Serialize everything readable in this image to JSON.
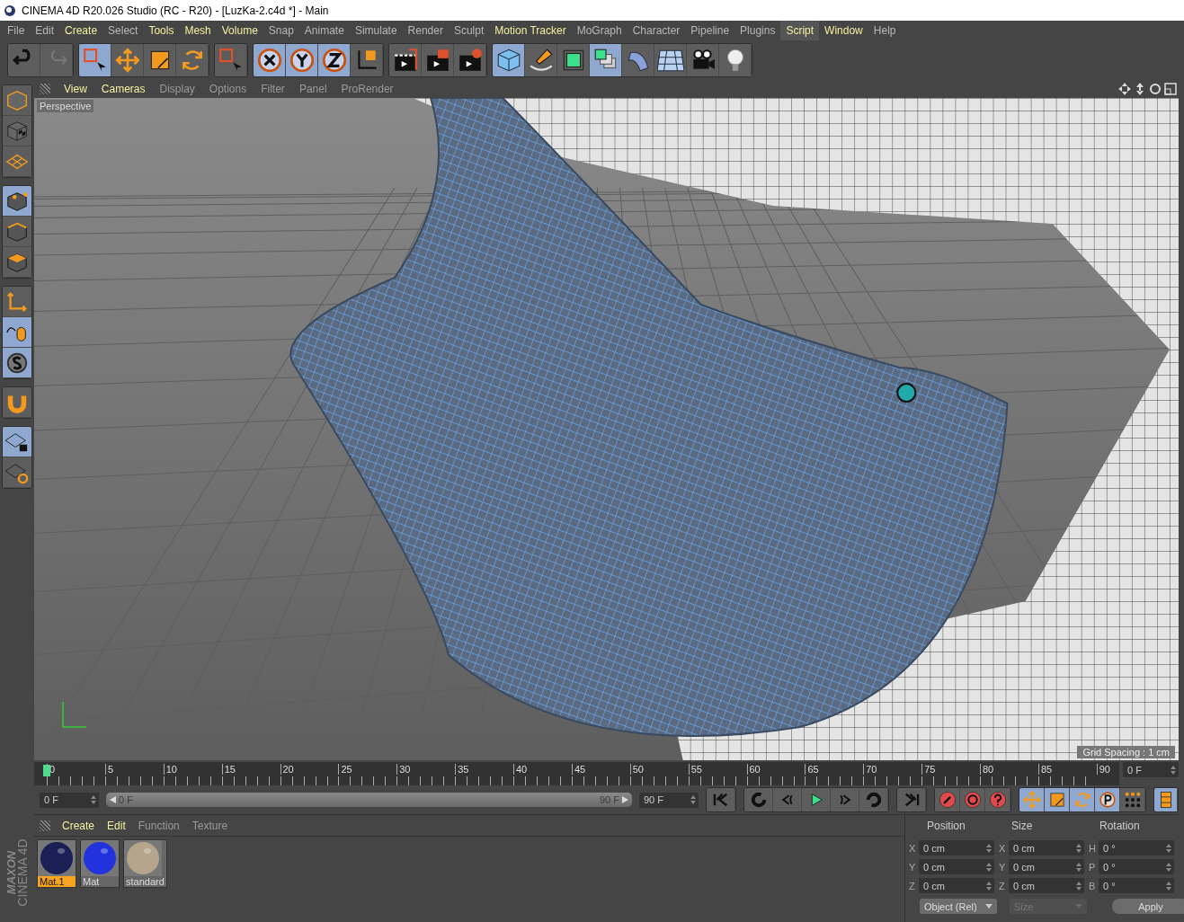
{
  "window": {
    "title": "CINEMA 4D R20.026 Studio (RC - R20) - [LuzKa-2.c4d *] - Main"
  },
  "menu": [
    {
      "label": "File",
      "accent": false,
      "selected": false
    },
    {
      "label": "Edit",
      "accent": false,
      "selected": false
    },
    {
      "label": "Create",
      "accent": true,
      "selected": false
    },
    {
      "label": "Select",
      "accent": false,
      "selected": false
    },
    {
      "label": "Tools",
      "accent": true,
      "selected": false
    },
    {
      "label": "Mesh",
      "accent": true,
      "selected": false
    },
    {
      "label": "Volume",
      "accent": true,
      "selected": false
    },
    {
      "label": "Snap",
      "accent": false,
      "selected": false
    },
    {
      "label": "Animate",
      "accent": false,
      "selected": false
    },
    {
      "label": "Simulate",
      "accent": false,
      "selected": false
    },
    {
      "label": "Render",
      "accent": false,
      "selected": false
    },
    {
      "label": "Sculpt",
      "accent": false,
      "selected": false
    },
    {
      "label": "Motion Tracker",
      "accent": true,
      "selected": false
    },
    {
      "label": "MoGraph",
      "accent": false,
      "selected": false
    },
    {
      "label": "Character",
      "accent": false,
      "selected": false
    },
    {
      "label": "Pipeline",
      "accent": false,
      "selected": false
    },
    {
      "label": "Plugins",
      "accent": false,
      "selected": false
    },
    {
      "label": "Script",
      "accent": true,
      "selected": true
    },
    {
      "label": "Window",
      "accent": true,
      "selected": false
    },
    {
      "label": "Help",
      "accent": false,
      "selected": false
    }
  ],
  "toolbar": [
    [
      {
        "kind": "undo",
        "active": false
      },
      {
        "kind": "redo",
        "active": false
      }
    ],
    [
      {
        "kind": "live-select",
        "active": true
      },
      {
        "kind": "move",
        "active": false
      },
      {
        "kind": "scale",
        "active": false
      },
      {
        "kind": "rotate",
        "active": false
      }
    ],
    [
      {
        "kind": "rect-select",
        "active": false
      }
    ],
    [
      {
        "kind": "x",
        "active": true
      },
      {
        "kind": "y",
        "active": true
      },
      {
        "kind": "z",
        "active": true
      },
      {
        "kind": "coord",
        "active": false
      }
    ],
    [
      {
        "kind": "render-view",
        "active": false
      },
      {
        "kind": "render-picture",
        "active": false
      },
      {
        "kind": "render-settings",
        "active": false
      }
    ],
    [
      {
        "kind": "cube",
        "active": true
      },
      {
        "kind": "pen",
        "active": false
      },
      {
        "kind": "subdivision",
        "active": false
      },
      {
        "kind": "cloner",
        "active": true
      },
      {
        "kind": "bend",
        "active": false
      },
      {
        "kind": "floor",
        "active": false
      },
      {
        "kind": "camera",
        "active": false
      },
      {
        "kind": "light",
        "active": false
      }
    ]
  ],
  "viewport": {
    "menu": [
      {
        "label": "View",
        "accent": true
      },
      {
        "label": "Cameras",
        "accent": true
      },
      {
        "label": "Display",
        "accent": false
      },
      {
        "label": "Options",
        "accent": false
      },
      {
        "label": "Filter",
        "accent": false
      },
      {
        "label": "Panel",
        "accent": false
      },
      {
        "label": "ProRender",
        "accent": false
      }
    ],
    "camera": "Perspective",
    "grid_spacing": "Grid Spacing : 1 cm"
  },
  "left_toolbar": [
    [
      {
        "kind": "model",
        "active": false
      },
      {
        "kind": "texture",
        "active": false
      },
      {
        "kind": "workplane",
        "active": false
      }
    ],
    [
      {
        "kind": "points",
        "active": true
      },
      {
        "kind": "edges",
        "active": false
      },
      {
        "kind": "polygons",
        "active": false
      }
    ],
    [
      {
        "kind": "axis",
        "active": false
      },
      {
        "kind": "tweak",
        "active": true
      },
      {
        "kind": "solo",
        "active": true
      }
    ],
    [
      {
        "kind": "magnet",
        "active": false
      }
    ],
    [
      {
        "kind": "lock-workplane",
        "active": true
      },
      {
        "kind": "planar-workplane",
        "active": false
      }
    ]
  ],
  "logo": {
    "brand": "MAXON",
    "product": "CINEMA 4D"
  },
  "timeline": {
    "ticks": [
      "0",
      "5",
      "10",
      "15",
      "20",
      "25",
      "30",
      "35",
      "40",
      "45",
      "50",
      "55",
      "60",
      "65",
      "70",
      "75",
      "80",
      "85",
      "90"
    ],
    "current_frame": "0 F",
    "start": "0 F",
    "range": {
      "start": "0 F",
      "end": "90 F"
    },
    "end": "90 F"
  },
  "transport": [
    [
      {
        "kind": "first"
      }
    ],
    [
      {
        "kind": "prev-key"
      },
      {
        "kind": "prev-frame"
      },
      {
        "kind": "play"
      },
      {
        "kind": "next-frame"
      },
      {
        "kind": "next-key"
      }
    ],
    [
      {
        "kind": "last"
      }
    ]
  ],
  "keys": [
    {
      "kind": "record",
      "active": false
    },
    {
      "kind": "autokey",
      "active": false
    },
    {
      "kind": "keyhelp",
      "active": false
    }
  ],
  "key_tracks": [
    {
      "kind": "move",
      "active": true
    },
    {
      "kind": "scale",
      "active": true
    },
    {
      "kind": "rotate",
      "active": true
    },
    {
      "kind": "param",
      "active": true
    },
    {
      "kind": "pla",
      "active": false
    }
  ],
  "timeline_button": {
    "active": true
  },
  "materials": {
    "menu": [
      {
        "label": "Create",
        "accent": true
      },
      {
        "label": "Edit",
        "accent": true
      },
      {
        "label": "Function",
        "accent": false
      },
      {
        "label": "Texture",
        "accent": false
      }
    ],
    "items": [
      {
        "name": "Mat.1",
        "color": "#1a1f55",
        "selected": true
      },
      {
        "name": "Mat",
        "color": "#2233dd",
        "selected": false
      },
      {
        "name": "standard",
        "color": "#b5a58c",
        "selected": false
      }
    ]
  },
  "coordinates": {
    "columns": [
      "Position",
      "Size",
      "Rotation"
    ],
    "rows": [
      [
        {
          "axis": "X",
          "value": "0 cm"
        },
        {
          "axis": "X",
          "value": "0 cm"
        },
        {
          "axis": "H",
          "value": "0 °"
        }
      ],
      [
        {
          "axis": "Y",
          "value": "0 cm"
        },
        {
          "axis": "Y",
          "value": "0 cm"
        },
        {
          "axis": "P",
          "value": "0 °"
        }
      ],
      [
        {
          "axis": "Z",
          "value": "0 cm"
        },
        {
          "axis": "Z",
          "value": "0 cm"
        },
        {
          "axis": "B",
          "value": "0 °"
        }
      ]
    ],
    "mode": {
      "label": "Object (Rel)",
      "disabled": false
    },
    "size_mode": {
      "label": "Size",
      "disabled": true
    },
    "apply": "Apply"
  }
}
